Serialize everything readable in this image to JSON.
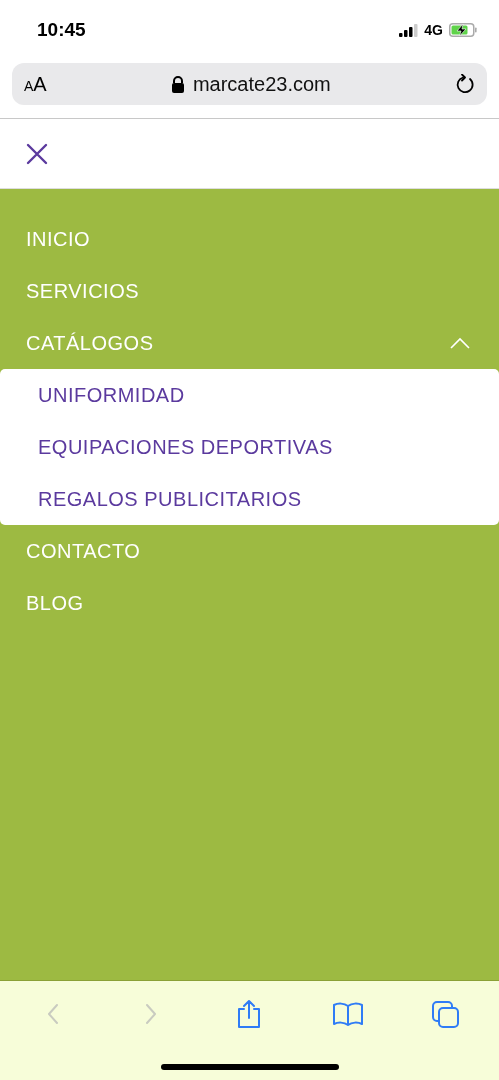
{
  "status_bar": {
    "time": "10:45",
    "network": "4G",
    "charging": true
  },
  "address_bar": {
    "text_size_label": "AA",
    "url": "marcate23.com",
    "secure": true
  },
  "menu": {
    "open": true,
    "items": [
      {
        "label": "INICIO"
      },
      {
        "label": "SERVICIOS"
      },
      {
        "label": "CATÁLOGOS",
        "expanded": true,
        "children": [
          {
            "label": "UNIFORMIDAD"
          },
          {
            "label": "EQUIPACIONES DEPORTIVAS"
          },
          {
            "label": "REGALOS PUBLICITARIOS"
          }
        ]
      },
      {
        "label": "CONTACTO"
      },
      {
        "label": "BLOG"
      }
    ]
  },
  "toolbar": [
    {
      "kind": "back",
      "disabled": true
    },
    {
      "kind": "forward",
      "disabled": true
    },
    {
      "kind": "share",
      "disabled": false
    },
    {
      "kind": "bookmarks",
      "disabled": false
    },
    {
      "kind": "tabs",
      "disabled": false
    }
  ]
}
